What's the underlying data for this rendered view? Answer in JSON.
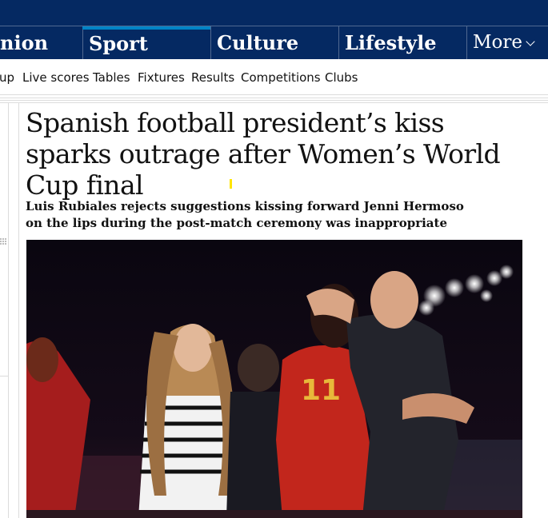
{
  "nav": {
    "pillars": [
      {
        "label": "nion"
      },
      {
        "label": "Sport"
      },
      {
        "label": "Culture"
      },
      {
        "label": "Lifestyle"
      },
      {
        "label": "More"
      }
    ],
    "active": "Sport",
    "accent_color": "#0084c6",
    "bar_color": "#052962"
  },
  "subnav": {
    "items": [
      "up",
      "Live scores",
      "Tables",
      "Fixtures",
      "Results",
      "Competitions",
      "Clubs"
    ]
  },
  "article": {
    "headline": "Spanish football president’s kiss sparks outrage after Women’s World Cup final",
    "standfirst": "Luis Rubiales rejects suggestions kissing forward Jenni Hermoso on the lips during the post-match ceremony was inappropriate",
    "hero": {
      "shirt_number": "11"
    }
  }
}
